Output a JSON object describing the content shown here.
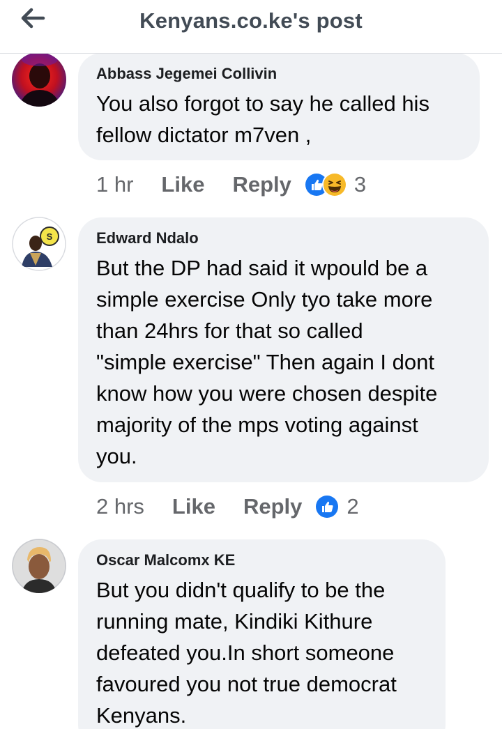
{
  "header": {
    "title": "Kenyans.co.ke's post",
    "back_icon": "arrow-left-icon"
  },
  "comments": [
    {
      "author": "Abbass Jegemei Collivin",
      "text_lines": [
        "You also forgot to say he called his",
        "fellow dictator m7ven ,"
      ],
      "time": "1 hr",
      "like_label": "Like",
      "reply_label": "Reply",
      "reactions": [
        "like-reaction-icon",
        "haha-reaction-icon"
      ],
      "reaction_count": "3"
    },
    {
      "author": "Edward Ndalo",
      "text_lines": [
        "But the DP had said it wpould be a",
        "simple exercise Only tyo take more",
        "than 24hrs for that so called",
        "\"simple exercise\" Then again I dont",
        "know how you were chosen despite",
        "majority of the mps voting against",
        "you."
      ],
      "time": "2 hrs",
      "like_label": "Like",
      "reply_label": "Reply",
      "reactions": [
        "like-reaction-icon"
      ],
      "reaction_count": "2"
    },
    {
      "author": "Oscar Malcomx KE",
      "text_lines": [
        "But you didn't qualify to be the",
        "running mate, Kindiki Kithure",
        "defeated you.In short someone",
        "favoured you not true democrat",
        "Kenyans."
      ]
    }
  ],
  "colors": {
    "bubble": "#f0f2f5",
    "meta_text": "#65676b",
    "like_blue": "#1877f2",
    "haha_yellow": "#f7b928"
  }
}
